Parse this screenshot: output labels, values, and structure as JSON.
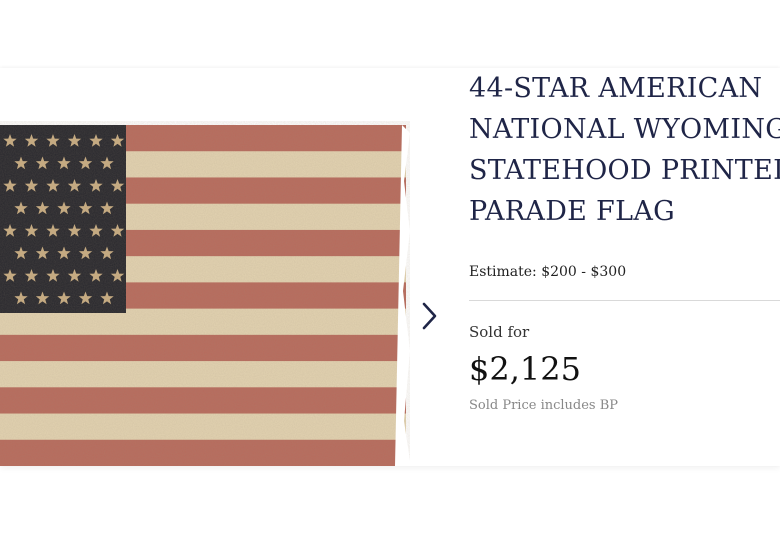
{
  "lot": {
    "title_lines": [
      "44-STAR AMERICAN",
      "NATIONAL WYOMING",
      "STATEHOOD PRINTED",
      "PARADE FLAG"
    ],
    "estimate": "Estimate: $200 - $300",
    "sold_label": "Sold for",
    "sold_price": "$2,125",
    "sold_note": "Sold Price includes BP"
  },
  "image": {
    "subject": "44-star American flag",
    "stars": 44
  },
  "gallery": {
    "next_icon": "chevron-right-icon"
  },
  "colors": {
    "title": "#1f2547",
    "stripe_red": "#b86a5c",
    "stripe_white": "#e3d3b1",
    "canton": "#26262c",
    "star": "#c9ad82"
  }
}
